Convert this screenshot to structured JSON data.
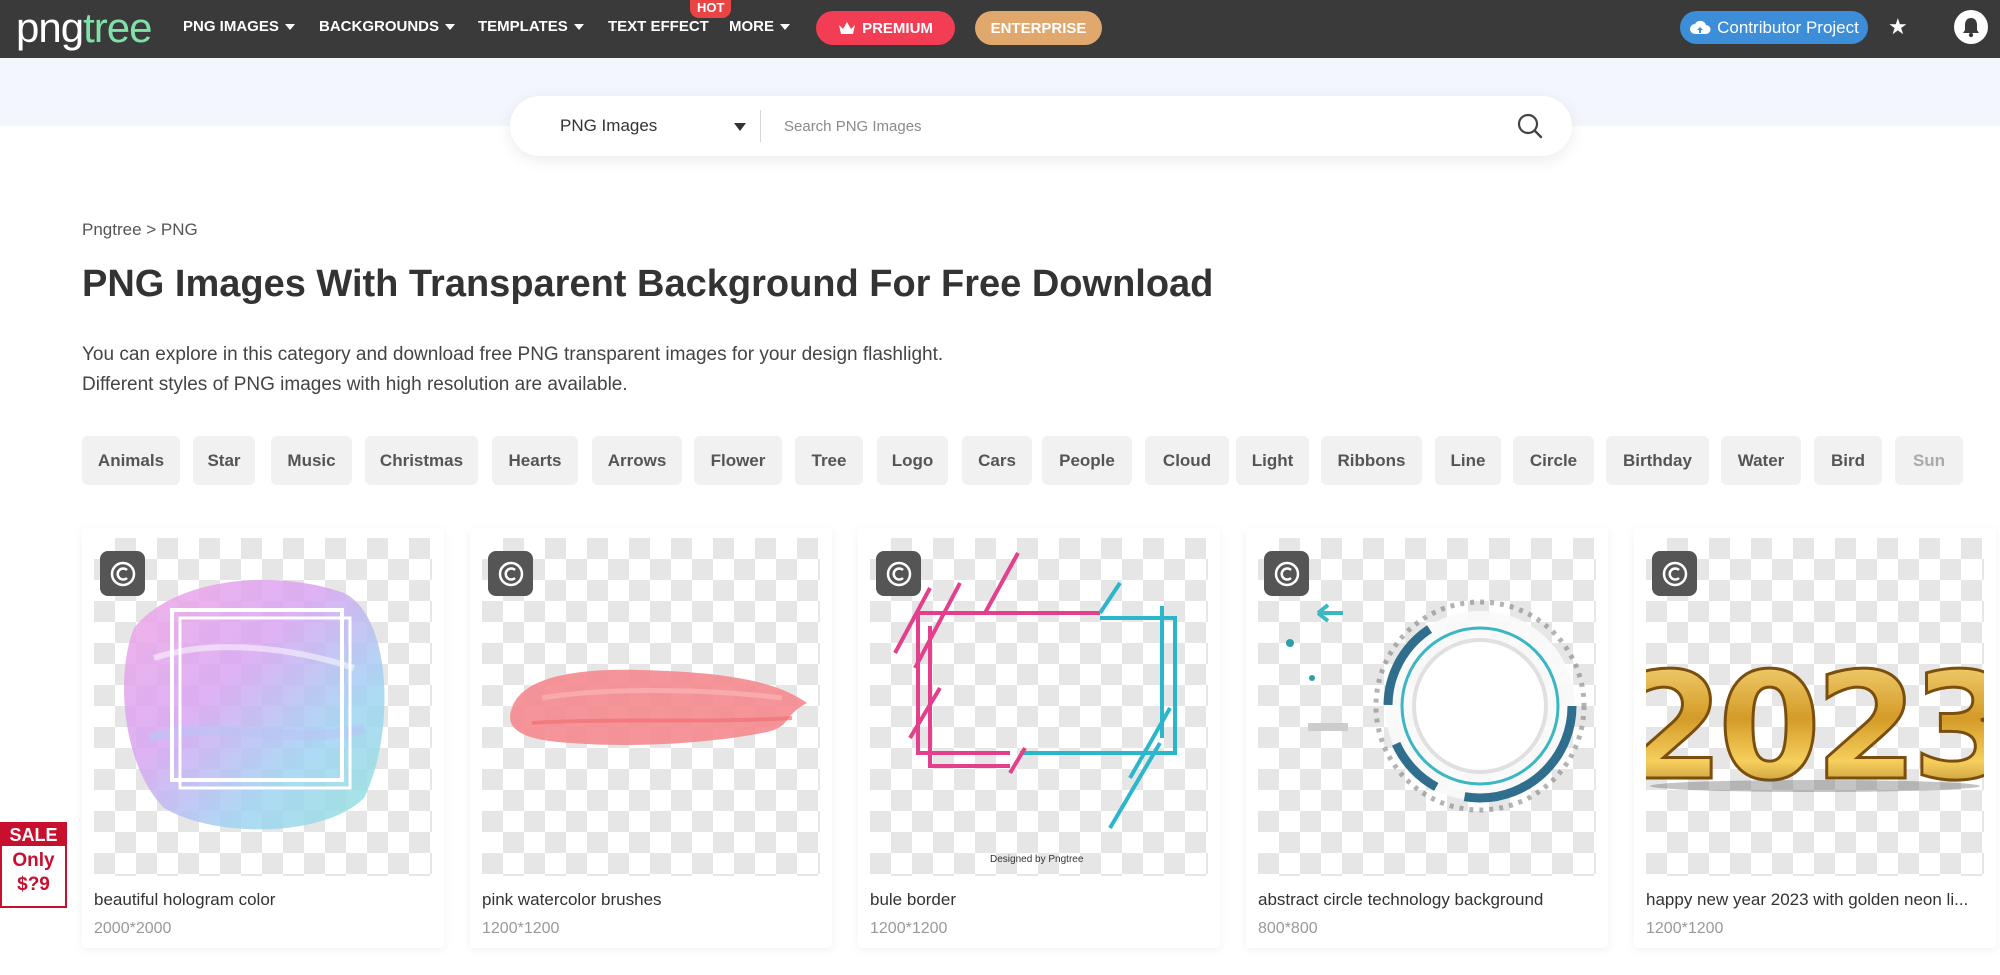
{
  "nav": {
    "logo_png": "png",
    "logo_tree": "tree",
    "items": [
      {
        "label": "PNG IMAGES"
      },
      {
        "label": "BACKGROUNDS"
      },
      {
        "label": "TEMPLATES"
      },
      {
        "label": "TEXT EFFECT"
      },
      {
        "label": "MORE"
      }
    ],
    "hot_badge": "HOT",
    "premium_label": "PREMIUM",
    "enterprise_label": "ENTERPRISE",
    "contributor_label": "Contributor Project",
    "icons": [
      "crown-icon",
      "upload-cloud-icon",
      "star-icon",
      "bell-icon"
    ]
  },
  "search": {
    "type_label": "PNG Images",
    "placeholder": "Search PNG Images"
  },
  "breadcrumb": "Pngtree > PNG",
  "page_title": "PNG Images With Transparent Background For Free Download",
  "description": {
    "line1": "You can explore in this category and download free PNG transparent images for your design flashlight.",
    "line2": "Different styles of PNG images with high resolution are available."
  },
  "tags": [
    "Animals",
    "Star",
    "Music",
    "Christmas",
    "Hearts",
    "Arrows",
    "Flower",
    "Tree",
    "Logo",
    "Cars",
    "People",
    "Cloud",
    "Light",
    "Ribbons",
    "Line",
    "Circle",
    "Birthday",
    "Water",
    "Bird",
    "Sun"
  ],
  "cards": [
    {
      "title": "beautiful hologram color",
      "size": "2000*2000"
    },
    {
      "title": "pink watercolor brushes",
      "size": "1200*1200"
    },
    {
      "title": "bule border",
      "size": "1200*1200",
      "credit": "Designed by Pngtree"
    },
    {
      "title": "abstract circle technology background",
      "size": "800*800"
    },
    {
      "title": "happy new year 2023 with golden neon li...",
      "size": "1200*1200",
      "art_text": "2023"
    }
  ],
  "sale": {
    "top": "SALE",
    "line1": "Only",
    "line2": "$?9"
  },
  "colors": {
    "nav_bg": "#3a3a3a",
    "premium": "#f23d54",
    "enterprise": "#e0a86c",
    "contributor": "#3d8ed9",
    "sale_red": "#c8102e"
  }
}
